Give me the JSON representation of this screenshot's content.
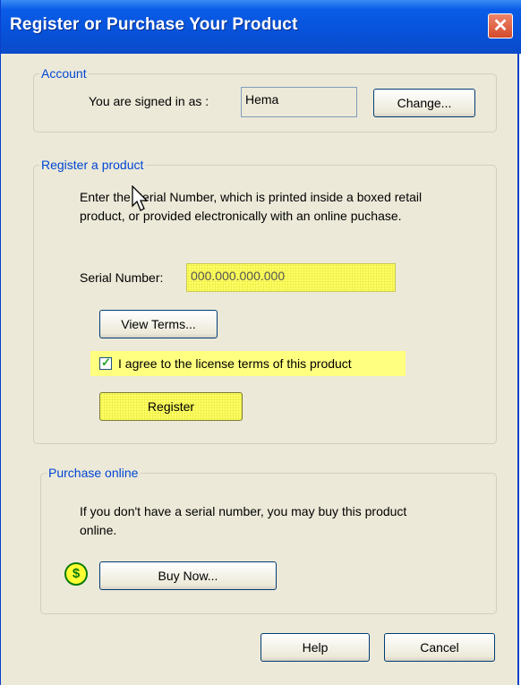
{
  "window": {
    "title": "Register or Purchase Your Product",
    "close_symbol": "✕"
  },
  "account": {
    "legend": "Account",
    "signed_in_label": "You are signed in as :",
    "username": "Hema",
    "change_label": "Change..."
  },
  "register": {
    "legend": "Register a product",
    "instructions": "Enter the Serial Number, which is printed inside a boxed retail product, or provided electronically with an online puchase.",
    "serial_label": "Serial Number:",
    "serial_value": "000.000.000.000",
    "view_terms_label": "View Terms...",
    "agree_checked": true,
    "agree_mark": "✓",
    "agree_label": "I agree to the license terms of this product",
    "register_label": "Register"
  },
  "purchase": {
    "legend": "Purchase online",
    "description": "If you don't have a serial number, you may buy this product online.",
    "currency_symbol": "$",
    "buy_label": "Buy Now..."
  },
  "footer": {
    "help_label": "Help",
    "cancel_label": "Cancel"
  },
  "icons": {
    "close": "close-icon",
    "dollar": "dollar-icon",
    "cursor": "mouse-cursor-icon",
    "check": "checkmark-icon"
  },
  "colors": {
    "title_bar": "#0752d9",
    "legend_text": "#0046d5",
    "highlight": "#ffff66",
    "dialog_bg": "#ece9d8",
    "close_button": "#d24a2a"
  }
}
